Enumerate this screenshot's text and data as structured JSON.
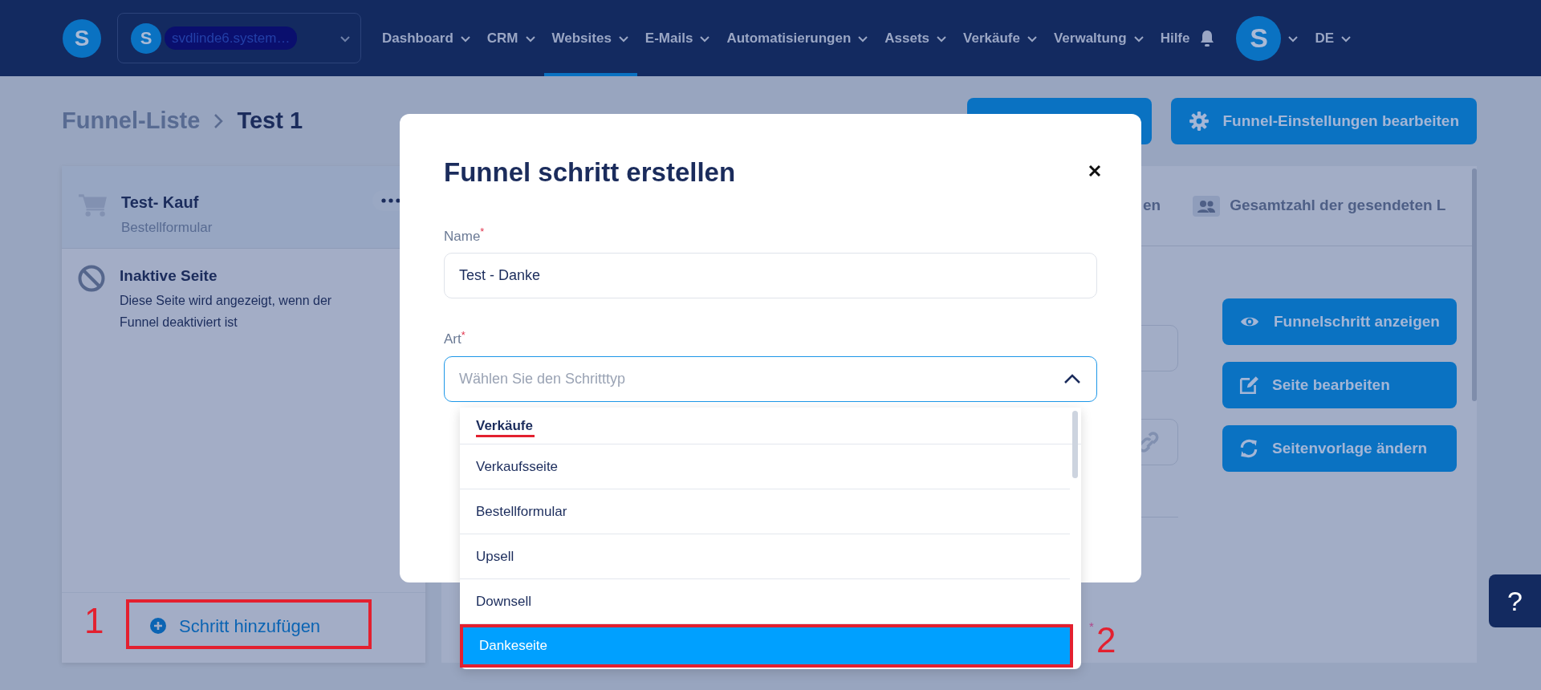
{
  "navbar": {
    "logo_letter": "S",
    "account": {
      "avatar_letter": "S",
      "name": "svdlinde6.system…"
    },
    "menu": [
      {
        "label": "Dashboard",
        "has_dropdown": true,
        "selected": false
      },
      {
        "label": "CRM",
        "has_dropdown": true,
        "selected": false
      },
      {
        "label": "Websites",
        "has_dropdown": true,
        "selected": true
      },
      {
        "label": "E-Mails",
        "has_dropdown": true,
        "selected": false
      },
      {
        "label": "Automatisierungen",
        "has_dropdown": true,
        "selected": false
      },
      {
        "label": "Assets",
        "has_dropdown": true,
        "selected": false
      },
      {
        "label": "Verkäufe",
        "has_dropdown": true,
        "selected": false
      },
      {
        "label": "Verwaltung",
        "has_dropdown": true,
        "selected": false
      },
      {
        "label": "Hilfe",
        "has_dropdown": false,
        "selected": false
      }
    ],
    "user": {
      "avatar_letter": "S"
    },
    "language": "DE"
  },
  "breadcrumb": [
    {
      "label": "Funnel-Liste"
    },
    {
      "label": "Test 1"
    }
  ],
  "header_buttons": [
    {
      "label": "Funnel-Einstellungen bearbeiten"
    }
  ],
  "steps": [
    {
      "title": "Test- Kauf",
      "type": "Bestellformular",
      "selected": true
    }
  ],
  "inactive_page": {
    "title": "Inaktive Seite",
    "description": "Diese Seite wird angezeigt, wenn der Funnel deaktiviert ist"
  },
  "add_step_button": {
    "label": "Schritt hinzufügen"
  },
  "detail_tabs": [
    {
      "label": "en"
    },
    {
      "label": "Gesamtzahl der gesendeten L"
    }
  ],
  "action_buttons": [
    {
      "label": "Funnelschritt anzeigen"
    },
    {
      "label": "Seite bearbeiten"
    },
    {
      "label": "Seitenvorlage ändern"
    }
  ],
  "background_required_mark": "*",
  "annotations": [
    {
      "label": "1"
    },
    {
      "label": "2"
    }
  ],
  "modal": {
    "title": "Funnel schritt erstellen",
    "fields": [
      {
        "kind": "text",
        "label": "Name",
        "required": true,
        "value": "Test - Danke"
      },
      {
        "kind": "select",
        "label": "Art",
        "required": true,
        "placeholder": "Wählen Sie den Schritttyp",
        "expanded": true
      }
    ],
    "dropdown": {
      "group": "Verkäufe",
      "options": [
        {
          "label": "Verkaufsseite",
          "selected": false
        },
        {
          "label": "Bestellformular",
          "selected": false
        },
        {
          "label": "Upsell",
          "selected": false
        },
        {
          "label": "Downsell",
          "selected": false
        },
        {
          "label": "Dankeseite",
          "selected": true
        }
      ]
    }
  },
  "help_button": {
    "label": "?"
  }
}
